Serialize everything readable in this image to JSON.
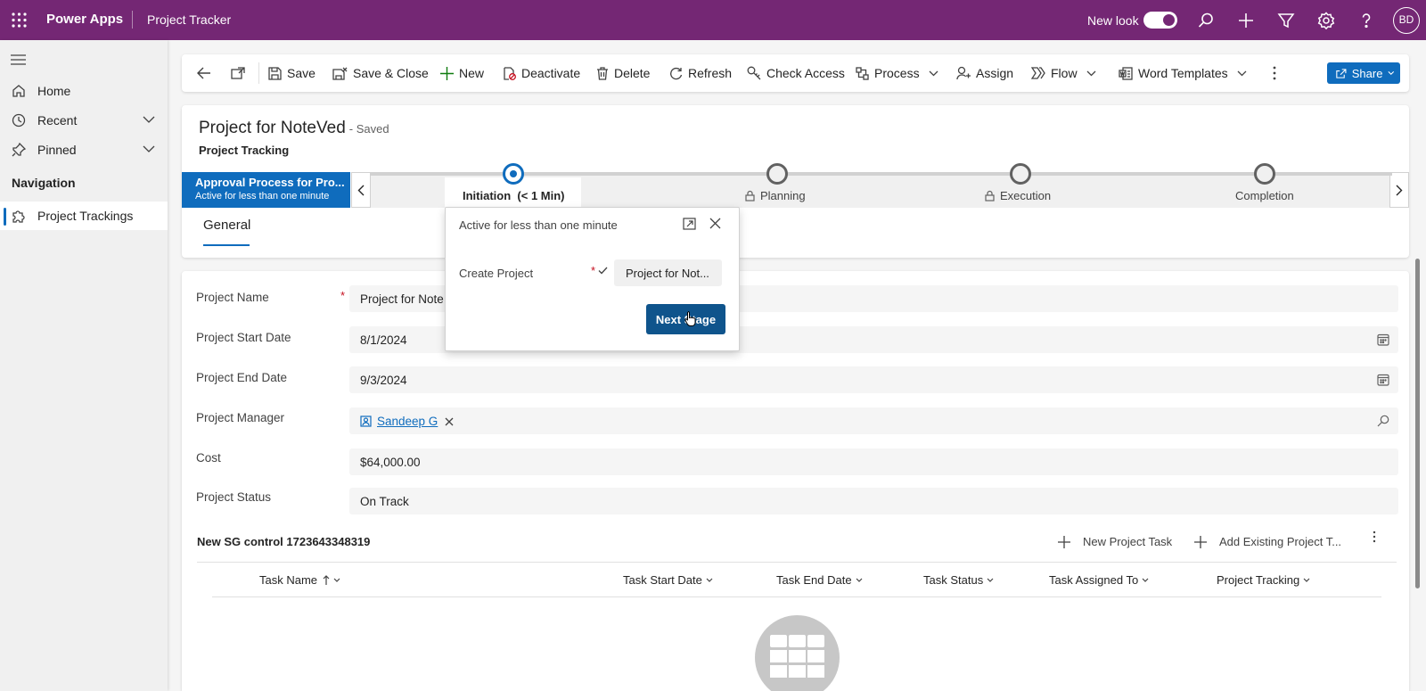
{
  "topbar": {
    "app_name": "Power Apps",
    "page_name": "Project Tracker",
    "new_look_label": "New look",
    "new_look_on": true,
    "avatar_initials": "BD",
    "icons": [
      "waffle-icon",
      "search-icon",
      "plus-icon",
      "filter-icon",
      "settings-icon",
      "help-icon"
    ]
  },
  "sidebar": {
    "items": [
      {
        "label": "Home",
        "icon": "home-icon"
      },
      {
        "label": "Recent",
        "icon": "clock-icon"
      },
      {
        "label": "Pinned",
        "icon": "pin-icon"
      }
    ],
    "section_title": "Navigation",
    "nav_items": [
      {
        "label": "Project Trackings",
        "icon": "puzzle-icon",
        "active": true
      }
    ]
  },
  "commands": {
    "save": "Save",
    "save_close": "Save & Close",
    "new": "New",
    "deactivate": "Deactivate",
    "delete": "Delete",
    "refresh": "Refresh",
    "check_access": "Check Access",
    "process": "Process",
    "assign": "Assign",
    "flow": "Flow",
    "word_templates": "Word Templates",
    "share": "Share"
  },
  "record": {
    "title": "Project for NoteVed",
    "saved_status": "- Saved",
    "entity": "Project Tracking"
  },
  "bpf": {
    "process_name": "Approval Process for Pro...",
    "process_status": "Active for less than one minute",
    "stages": [
      {
        "label": "Initiation",
        "duration": "(< 1 Min)",
        "active": true,
        "locked": false
      },
      {
        "label": "Planning",
        "locked": true
      },
      {
        "label": "Execution",
        "locked": true
      },
      {
        "label": "Completion",
        "locked": false
      }
    ]
  },
  "tabs": {
    "general": "General"
  },
  "flyout": {
    "title": "Active for less than one minute",
    "field_label": "Create Project",
    "field_value": "Project for Not...",
    "next_button": "Next Stage"
  },
  "fields": {
    "project_name": {
      "label": "Project Name",
      "value": "Project for Note",
      "required": true
    },
    "start_date": {
      "label": "Project Start Date",
      "value": "8/1/2024"
    },
    "end_date": {
      "label": "Project End Date",
      "value": "9/3/2024"
    },
    "manager": {
      "label": "Project Manager",
      "value": "Sandeep G"
    },
    "cost": {
      "label": "Cost",
      "value": "$64,000.00"
    },
    "status": {
      "label": "Project Status",
      "value": "On Track"
    }
  },
  "subgrid": {
    "title": "New SG control 1723643348319",
    "new_task": "New Project Task",
    "add_existing": "Add Existing Project T...",
    "columns": [
      "Task Name",
      "Task Start Date",
      "Task End Date",
      "Task Status",
      "Task Assigned To",
      "Project Tracking"
    ]
  },
  "colors": {
    "topbar": "#742774",
    "accent": "#0f6cbd",
    "next_stage_button": "#0f548c",
    "required": "#c50f1f"
  }
}
